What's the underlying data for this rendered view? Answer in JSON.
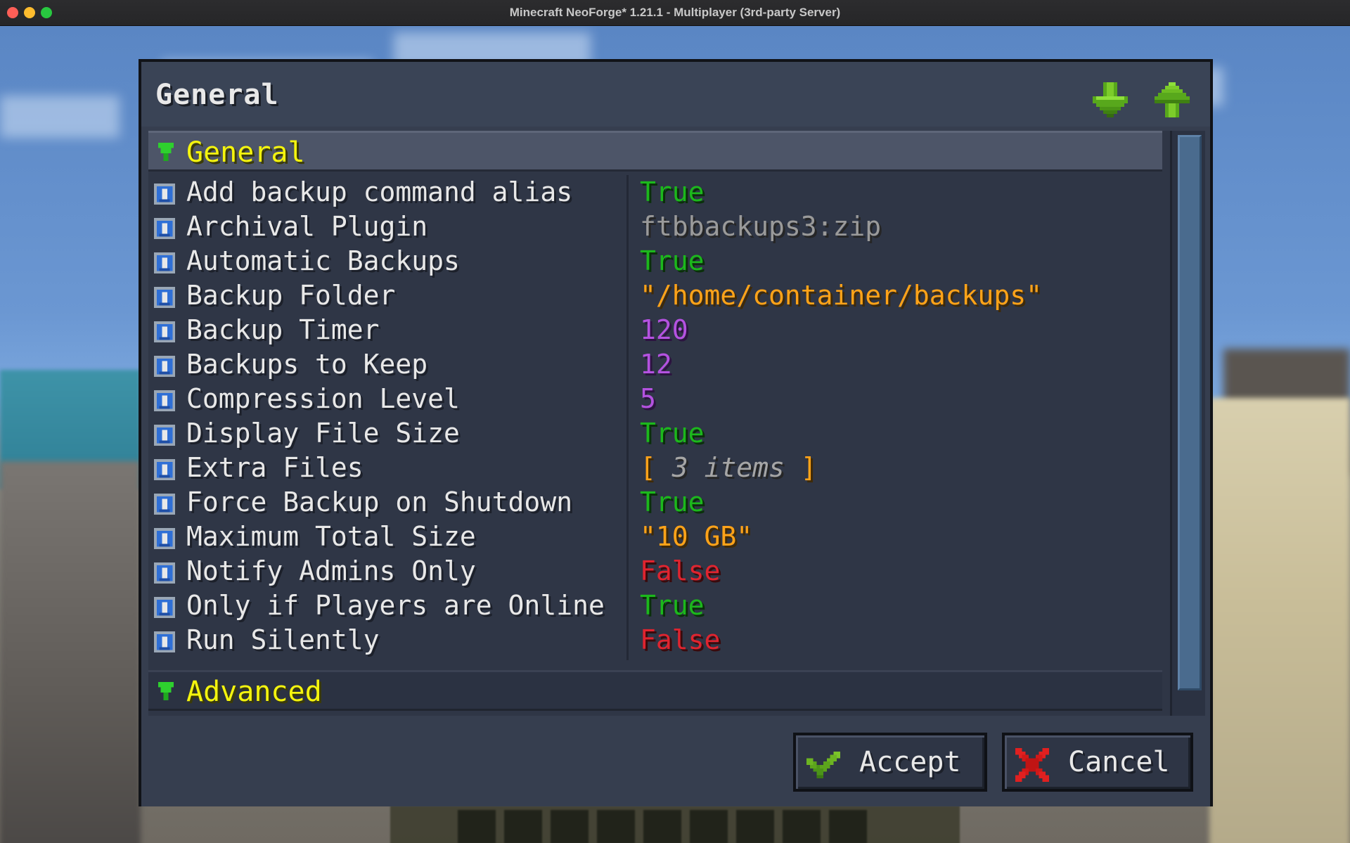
{
  "window": {
    "title": "Minecraft NeoForge* 1.21.1 - Multiplayer (3rd-party Server)"
  },
  "dialog": {
    "title": "General",
    "nav": {
      "down_icon": "green-down-arrow-icon",
      "up_icon": "green-up-arrow-icon"
    },
    "categories": [
      {
        "label": "General",
        "expanded": true,
        "rows": [
          {
            "label": "Add backup command alias",
            "value": "True",
            "type": "bool-true"
          },
          {
            "label": "Archival Plugin",
            "value": "ftbbackups3:zip",
            "type": "select"
          },
          {
            "label": "Automatic Backups",
            "value": "True",
            "type": "bool-true"
          },
          {
            "label": "Backup Folder",
            "value": "\"/home/container/backups\"",
            "type": "string"
          },
          {
            "label": "Backup Timer",
            "value": "120",
            "type": "number"
          },
          {
            "label": "Backups to Keep",
            "value": "12",
            "type": "number"
          },
          {
            "label": "Compression Level",
            "value": "5",
            "type": "number"
          },
          {
            "label": "Display File Size",
            "value": "True",
            "type": "bool-true"
          },
          {
            "label": "Extra Files",
            "value_open": "[ ",
            "value_items": "3 items",
            "value_close": " ]",
            "type": "list"
          },
          {
            "label": "Force Backup on Shutdown",
            "value": "True",
            "type": "bool-true"
          },
          {
            "label": "Maximum Total Size",
            "value": "\"10 GB\"",
            "type": "string"
          },
          {
            "label": "Notify Admins Only",
            "value": "False",
            "type": "bool-false"
          },
          {
            "label": "Only if Players are Online",
            "value": "True",
            "type": "bool-true"
          },
          {
            "label": "Run Silently",
            "value": "False",
            "type": "bool-false"
          }
        ]
      },
      {
        "label": "Advanced",
        "expanded": false
      }
    ],
    "footer": {
      "accept_label": "Accept",
      "cancel_label": "Cancel"
    }
  },
  "colors": {
    "bool_true": "#1cb81c",
    "bool_false": "#e0242f",
    "string": "#ffa319",
    "number": "#b452e0",
    "select": "#9a9a9a",
    "category": "#f4f40e",
    "dialog_bg": "#363e4f"
  }
}
